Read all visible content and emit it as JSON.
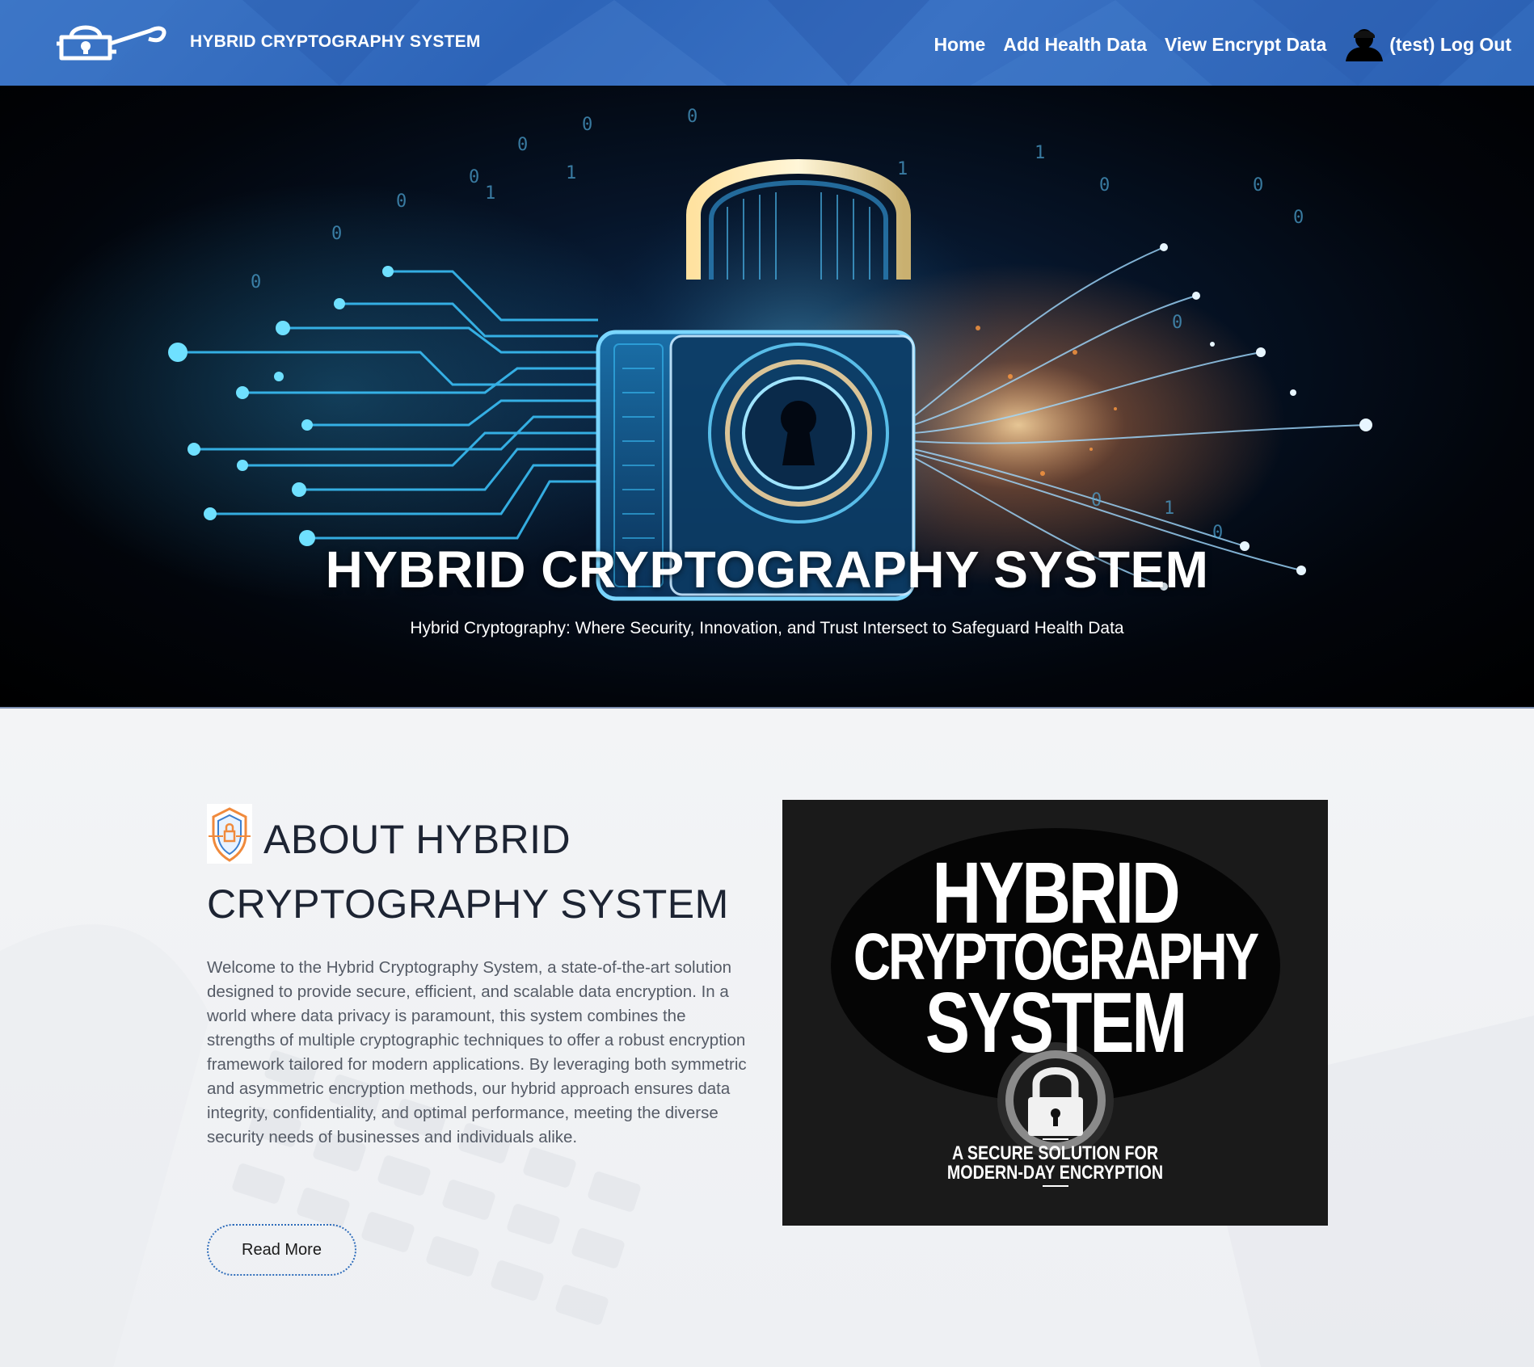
{
  "nav": {
    "brand_title": "HYBRID CRYPTOGRAPHY SYSTEM",
    "links": [
      "Home",
      "Add Health Data",
      "View Encrypt Data"
    ],
    "user_logout": "(test) Log Out",
    "logo_icon": "padlock-key-logo-icon",
    "user_icon": "user-silhouette-icon",
    "bg_color": "#3168ba"
  },
  "hero": {
    "title": "HYBRID CRYPTOGRAPHY SYSTEM",
    "subtitle": "Hybrid Cryptography: Where Security, Innovation, and Trust Intersect to Safeguard Health Data"
  },
  "about": {
    "heading": "ABOUT HYBRID CRYPTOGRAPHY SYSTEM",
    "paragraph": "Welcome to the Hybrid Cryptography System, a state-of-the-art solution designed to provide secure, efficient, and scalable data encryption. In a world where data privacy is paramount, this system combines the strengths of multiple cryptographic techniques to offer a robust encryption framework tailored for modern applications. By leveraging both symmetric and asymmetric encryption methods, our hybrid approach ensures data integrity, confidentiality, and optimal performance, meeting the diverse security needs of businesses and individuals alike.",
    "read_more": "Read More",
    "icon": "shield-lock-icon"
  },
  "poster": {
    "line1": "HYBRID",
    "line2": "CRYPTOGRAPHY",
    "line3": "SYSTEM",
    "sub1": "A SECURE SOLUTION FOR",
    "sub2": "MODERN-DAY ENCRYPTION"
  }
}
